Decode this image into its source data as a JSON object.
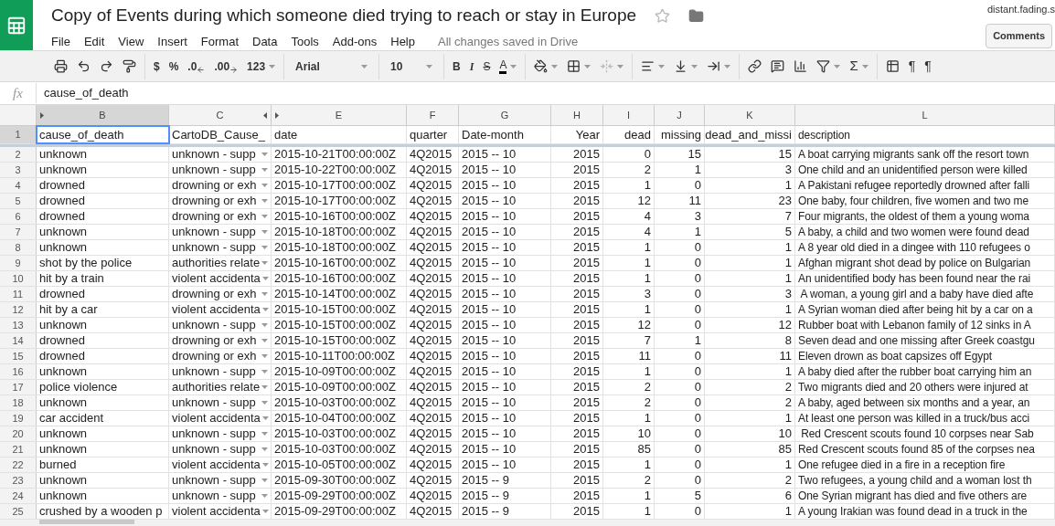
{
  "document": {
    "title": "Copy of Events during which someone died trying to reach or stay in Europe",
    "starred": false,
    "save_status": "All changes saved in Drive"
  },
  "account": {
    "name": "distant.fading.s"
  },
  "comments_button": "Comments",
  "menu": [
    "File",
    "Edit",
    "View",
    "Insert",
    "Format",
    "Data",
    "Tools",
    "Add-ons",
    "Help"
  ],
  "toolbar": {
    "number_formats": [
      "$",
      "%",
      ".0",
      ".00",
      "123"
    ],
    "font": "Arial",
    "font_size": "10",
    "styles": [
      "B",
      "I",
      "S",
      "A"
    ],
    "sum": "Σ",
    "direction": [
      "¶",
      "¶"
    ]
  },
  "formula_bar": {
    "label": "fx",
    "value": "cause_of_death"
  },
  "columns": [
    {
      "letter": "B",
      "selected": true,
      "numeric": false,
      "dropdown": false,
      "hidden_before": true,
      "hidden_after": false
    },
    {
      "letter": "C",
      "selected": false,
      "numeric": false,
      "dropdown": true,
      "hidden_before": false,
      "hidden_after": true
    },
    {
      "letter": "E",
      "selected": false,
      "numeric": false,
      "dropdown": false,
      "hidden_before": true,
      "hidden_after": false
    },
    {
      "letter": "F",
      "selected": false,
      "numeric": false,
      "dropdown": false,
      "hidden_before": false,
      "hidden_after": false
    },
    {
      "letter": "G",
      "selected": false,
      "numeric": false,
      "dropdown": false,
      "hidden_before": false,
      "hidden_after": false
    },
    {
      "letter": "H",
      "selected": false,
      "numeric": true,
      "dropdown": false,
      "hidden_before": false,
      "hidden_after": false
    },
    {
      "letter": "I",
      "selected": false,
      "numeric": true,
      "dropdown": false,
      "hidden_before": false,
      "hidden_after": false
    },
    {
      "letter": "J",
      "selected": false,
      "numeric": true,
      "dropdown": false,
      "hidden_before": false,
      "hidden_after": false
    },
    {
      "letter": "K",
      "selected": false,
      "numeric": true,
      "dropdown": false,
      "hidden_before": false,
      "hidden_after": false
    },
    {
      "letter": "L",
      "selected": false,
      "numeric": false,
      "dropdown": false,
      "hidden_before": false,
      "hidden_after": false
    }
  ],
  "header_row": {
    "number": "1",
    "selected": true,
    "cells": [
      "cause_of_death",
      "CartoDB_Cause_",
      "date",
      "quarter",
      "Date-month",
      "Year",
      "dead",
      "missing",
      "dead_and_missi",
      "description"
    ]
  },
  "rows": [
    {
      "number": "2",
      "cells": [
        "unknown",
        "unknown - supp",
        "2015-10-21T00:00:00Z",
        "4Q2015",
        "2015 -- 10",
        "2015",
        "0",
        "15",
        "15",
        "A boat carrying migrants sank off the resort town"
      ]
    },
    {
      "number": "3",
      "cells": [
        "unknown",
        "unknown - supp",
        "2015-10-22T00:00:00Z",
        "4Q2015",
        "2015 -- 10",
        "2015",
        "2",
        "1",
        "3",
        "One child and an unidentified person were killed"
      ]
    },
    {
      "number": "4",
      "cells": [
        "drowned",
        "drowning or exh",
        "2015-10-17T00:00:00Z",
        "4Q2015",
        "2015 -- 10",
        "2015",
        "1",
        "0",
        "1",
        "A Pakistani refugee reportedly drowned after falli"
      ]
    },
    {
      "number": "5",
      "cells": [
        "drowned",
        "drowning or exh",
        "2015-10-17T00:00:00Z",
        "4Q2015",
        "2015 -- 10",
        "2015",
        "12",
        "11",
        "23",
        "One baby, four children, five women and two me"
      ]
    },
    {
      "number": "6",
      "cells": [
        "drowned",
        "drowning or exh",
        "2015-10-16T00:00:00Z",
        "4Q2015",
        "2015 -- 10",
        "2015",
        "4",
        "3",
        "7",
        "Four migrants, the oldest of them a young woma"
      ]
    },
    {
      "number": "7",
      "cells": [
        "unknown",
        "unknown - supp",
        "2015-10-18T00:00:00Z",
        "4Q2015",
        "2015 -- 10",
        "2015",
        "4",
        "1",
        "5",
        "A baby, a child and two women were found dead"
      ]
    },
    {
      "number": "8",
      "cells": [
        "unknown",
        "unknown - supp",
        "2015-10-18T00:00:00Z",
        "4Q2015",
        "2015 -- 10",
        "2015",
        "1",
        "0",
        "1",
        "A 8 year old died in a dingee with 110 refugees o"
      ]
    },
    {
      "number": "9",
      "cells": [
        "shot by the police",
        "authorities relate",
        "2015-10-16T00:00:00Z",
        "4Q2015",
        "2015 -- 10",
        "2015",
        "1",
        "0",
        "1",
        "Afghan migrant shot dead by police on Bulgarian"
      ]
    },
    {
      "number": "10",
      "cells": [
        "hit by a train",
        "violent accidenta",
        "2015-10-16T00:00:00Z",
        "4Q2015",
        "2015 -- 10",
        "2015",
        "1",
        "0",
        "1",
        "An unidentified body has been found near the rai"
      ]
    },
    {
      "number": "11",
      "cells": [
        "drowned",
        "drowning or exh",
        "2015-10-14T00:00:00Z",
        "4Q2015",
        "2015 -- 10",
        "2015",
        "3",
        "0",
        "3",
        " A woman, a young girl and a baby have died afte"
      ]
    },
    {
      "number": "12",
      "cells": [
        "hit by a car",
        "violent accidenta",
        "2015-10-15T00:00:00Z",
        "4Q2015",
        "2015 -- 10",
        "2015",
        "1",
        "0",
        "1",
        "A Syrian woman died after being hit by a car on a"
      ]
    },
    {
      "number": "13",
      "cells": [
        "unknown",
        "unknown - supp",
        "2015-10-15T00:00:00Z",
        "4Q2015",
        "2015 -- 10",
        "2015",
        "12",
        "0",
        "12",
        "Rubber boat with Lebanon family of 12 sinks in A"
      ]
    },
    {
      "number": "14",
      "cells": [
        "drowned",
        "drowning or exh",
        "2015-10-15T00:00:00Z",
        "4Q2015",
        "2015 -- 10",
        "2015",
        "7",
        "1",
        "8",
        "Seven dead and one missing after Greek coastgu"
      ]
    },
    {
      "number": "15",
      "cells": [
        "drowned",
        "drowning or exh",
        "2015-10-11T00:00:00Z",
        "4Q2015",
        "2015 -- 10",
        "2015",
        "11",
        "0",
        "11",
        "Eleven drown as boat capsizes off Egypt"
      ]
    },
    {
      "number": "16",
      "cells": [
        "unknown",
        "unknown - supp",
        "2015-10-09T00:00:00Z",
        "4Q2015",
        "2015 -- 10",
        "2015",
        "1",
        "0",
        "1",
        "A baby died after the rubber boat carrying him an"
      ]
    },
    {
      "number": "17",
      "cells": [
        "police violence",
        "authorities relate",
        "2015-10-09T00:00:00Z",
        "4Q2015",
        "2015 -- 10",
        "2015",
        "2",
        "0",
        "2",
        "Two migrants died and 20 others were injured at"
      ]
    },
    {
      "number": "18",
      "cells": [
        "unknown",
        "unknown - supp",
        "2015-10-03T00:00:00Z",
        "4Q2015",
        "2015 -- 10",
        "2015",
        "2",
        "0",
        "2",
        "A baby, aged between six months and a year, an"
      ]
    },
    {
      "number": "19",
      "cells": [
        "car accident",
        "violent accidenta",
        "2015-10-04T00:00:00Z",
        "4Q2015",
        "2015 -- 10",
        "2015",
        "1",
        "0",
        "1",
        "At least one person was killed in a truck/bus acci"
      ]
    },
    {
      "number": "20",
      "cells": [
        "unknown",
        "unknown - supp",
        "2015-10-03T00:00:00Z",
        "4Q2015",
        "2015 -- 10",
        "2015",
        "10",
        "0",
        "10",
        " Red Crescent scouts found 10 corpses near Sab"
      ]
    },
    {
      "number": "21",
      "cells": [
        "unknown",
        "unknown - supp",
        "2015-10-03T00:00:00Z",
        "4Q2015",
        "2015 -- 10",
        "2015",
        "85",
        "0",
        "85",
        "Red Crescent scouts found 85 of the corpses nea"
      ]
    },
    {
      "number": "22",
      "cells": [
        "burned",
        "violent accidenta",
        "2015-10-05T00:00:00Z",
        "4Q2015",
        "2015 -- 10",
        "2015",
        "1",
        "0",
        "1",
        "One refugee died in a fire in a reception fire"
      ]
    },
    {
      "number": "23",
      "cells": [
        "unknown",
        "unknown - supp",
        "2015-09-30T00:00:00Z",
        "4Q2015",
        "2015 -- 9",
        "2015",
        "2",
        "0",
        "2",
        "Two refugees, a young child and a woman lost th"
      ]
    },
    {
      "number": "24",
      "cells": [
        "unknown",
        "unknown - supp",
        "2015-09-29T00:00:00Z",
        "4Q2015",
        "2015 -- 9",
        "2015",
        "1",
        "5",
        "6",
        "One Syrian migrant has died and five others are"
      ]
    },
    {
      "number": "25",
      "cells": [
        "crushed by a wooden p",
        "violent accidenta",
        "2015-09-29T00:00:00Z",
        "4Q2015",
        "2015 -- 9",
        "2015",
        "1",
        "0",
        "1",
        "A young Irakian was found dead in a truck in the"
      ]
    }
  ]
}
